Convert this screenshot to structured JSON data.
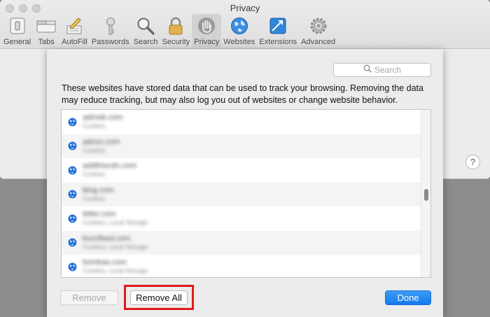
{
  "window": {
    "title": "Privacy"
  },
  "toolbar": {
    "items": [
      {
        "label": "General",
        "icon": "switch-icon"
      },
      {
        "label": "Tabs",
        "icon": "tabs-icon"
      },
      {
        "label": "AutoFill",
        "icon": "pencil-form-icon"
      },
      {
        "label": "Passwords",
        "icon": "key-icon"
      },
      {
        "label": "Search",
        "icon": "magnifier-icon"
      },
      {
        "label": "Security",
        "icon": "padlock-icon"
      },
      {
        "label": "Privacy",
        "icon": "hand-icon"
      },
      {
        "label": "Websites",
        "icon": "globe-icon"
      },
      {
        "label": "Extensions",
        "icon": "puzzle-icon"
      },
      {
        "label": "Advanced",
        "icon": "gear-icon"
      }
    ],
    "selected": "Privacy"
  },
  "help": {
    "label": "?"
  },
  "sheet": {
    "search_placeholder": "Search",
    "description": "These websites have stored data that can be used to track your browsing. Removing the data may reduce tracking, but may also log you out of websites or change website behavior.",
    "websites": [
      {
        "name": "admob.com",
        "info": "Cookies"
      },
      {
        "name": "adnxs.com",
        "info": "Cookies"
      },
      {
        "name": "addthiscdn.com",
        "info": "Cookies"
      },
      {
        "name": "bing.com",
        "info": "Cookies"
      },
      {
        "name": "bitter.com",
        "info": "Cookies, Local Storage"
      },
      {
        "name": "buzzfeed.com",
        "info": "Cookies, Local Storage"
      },
      {
        "name": "bombas.com",
        "info": "Cookies, Local Storage"
      }
    ],
    "buttons": {
      "remove": "Remove",
      "remove_all": "Remove All",
      "done": "Done"
    }
  },
  "colors": {
    "accent": "#1a7ef0",
    "highlight": "#e01a1a",
    "globe": "#2a74d6"
  }
}
